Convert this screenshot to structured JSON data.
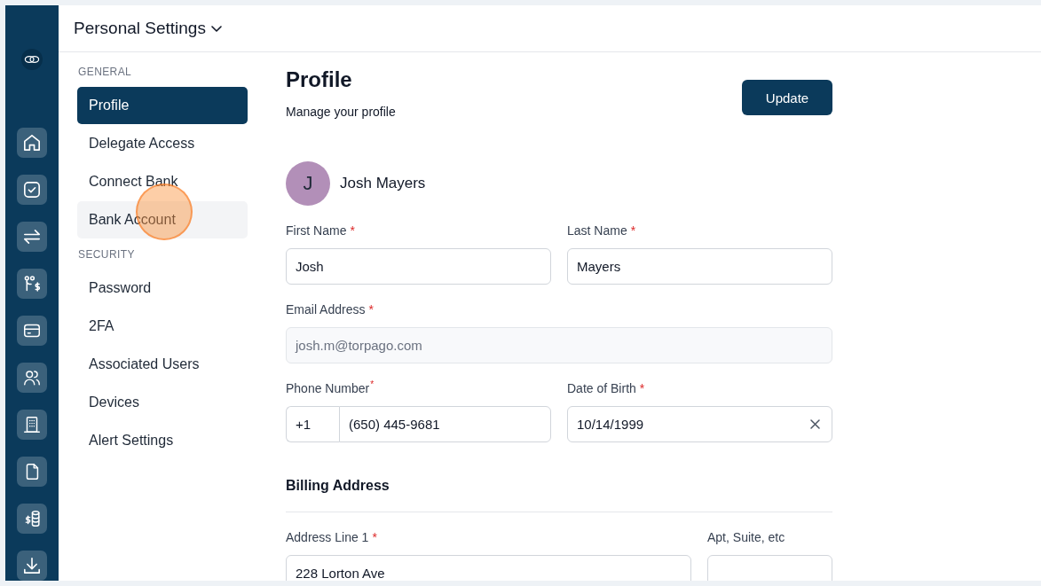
{
  "header": {
    "title": "Personal Settings"
  },
  "nav": {
    "groups": [
      {
        "heading": "GENERAL",
        "items": [
          {
            "label": "Profile",
            "selected": true,
            "hovered": false,
            "clicked": false
          },
          {
            "label": "Delegate Access",
            "selected": false,
            "hovered": false,
            "clicked": false
          },
          {
            "label": "Connect Bank",
            "selected": false,
            "hovered": false,
            "clicked": false
          },
          {
            "label": "Bank Account",
            "selected": false,
            "hovered": true,
            "clicked": true
          }
        ]
      },
      {
        "heading": "SECURITY",
        "items": [
          {
            "label": "Password",
            "selected": false,
            "hovered": false,
            "clicked": false
          },
          {
            "label": "2FA",
            "selected": false,
            "hovered": false,
            "clicked": false
          },
          {
            "label": "Associated Users",
            "selected": false,
            "hovered": false,
            "clicked": false
          },
          {
            "label": "Devices",
            "selected": false,
            "hovered": false,
            "clicked": false
          },
          {
            "label": "Alert Settings",
            "selected": false,
            "hovered": false,
            "clicked": false
          }
        ]
      }
    ]
  },
  "profile": {
    "title": "Profile",
    "subtitle": "Manage your profile",
    "update_button": "Update",
    "user": {
      "initial": "J",
      "name": "Josh Mayers"
    },
    "sections": [
      {
        "rows": [
          {
            "fields": [
              {
                "kind": "text",
                "label": "First Name",
                "required_mark": "*",
                "mark_raised": false,
                "value": "Josh",
                "disabled": false
              },
              {
                "kind": "text",
                "label": "Last Name",
                "required_mark": "*",
                "mark_raised": false,
                "value": "Mayers",
                "disabled": false
              }
            ]
          },
          {
            "fields": [
              {
                "kind": "text",
                "label": "Email Address",
                "required_mark": "*",
                "mark_raised": false,
                "value": "josh.m@torpago.com",
                "disabled": true
              }
            ]
          },
          {
            "fields": [
              {
                "kind": "phone",
                "label": "Phone Number",
                "required_mark": "*",
                "mark_raised": true,
                "prefix": "+1",
                "value": "(650) 445-9681",
                "disabled": false
              },
              {
                "kind": "date",
                "label": "Date of Birth",
                "required_mark": "*",
                "mark_raised": false,
                "value": "10/14/1999",
                "disabled": false
              }
            ]
          }
        ]
      },
      {
        "heading": "Billing Address",
        "rows": [
          {
            "fields": [
              {
                "kind": "text",
                "label": "Address Line 1",
                "required_mark": "*",
                "mark_raised": false,
                "value": "228 Lorton Ave",
                "disabled": false
              },
              {
                "kind": "text",
                "label": "Apt, Suite, etc",
                "disabled": false
              }
            ]
          }
        ]
      }
    ]
  }
}
